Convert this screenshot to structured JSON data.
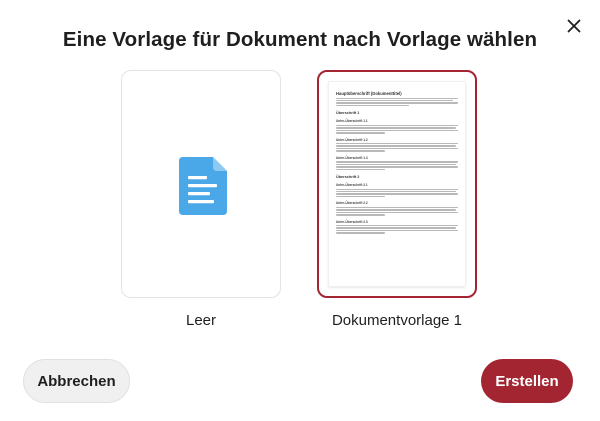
{
  "dialog": {
    "title": "Eine Vorlage für Dokument nach Vorlage wählen",
    "close_icon": "close-icon"
  },
  "templates": [
    {
      "label": "Leer",
      "icon": "document-icon",
      "selected": false
    },
    {
      "label": "Dokumentvorlage 1",
      "selected": true,
      "preview": {
        "heading": "Hauptüberschrift (Dokumenttitel)",
        "section_1": "Überschrift 1",
        "sub_1_1": "Unter-Überschrift 1.1",
        "sub_1_2": "Unter-Überschrift 1.2",
        "sub_1_3": "Unter-Überschrift 1.3",
        "section_2": "Überschrift 2",
        "sub_2_1": "Unter-Überschrift 2.1",
        "sub_2_2": "Unter-Überschrift 2.2",
        "sub_2_3": "Unter-Überschrift 2.3"
      }
    }
  ],
  "buttons": {
    "cancel": "Abbrechen",
    "create": "Erstellen"
  },
  "colors": {
    "accent": "#a32532",
    "doc_icon": "#4aa8e8",
    "card_border": "#e3e3e3"
  }
}
